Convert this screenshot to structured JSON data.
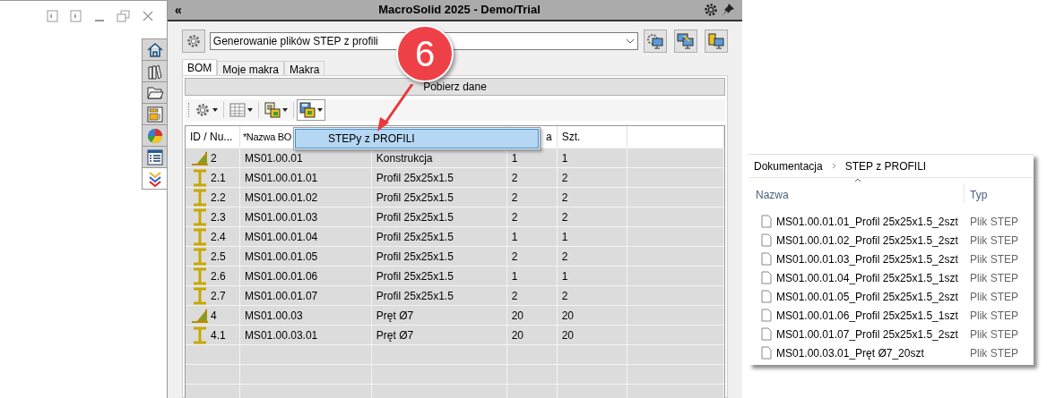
{
  "side_tabs": [
    {
      "kind": "home",
      "selected": false
    },
    {
      "kind": "library",
      "selected": false
    },
    {
      "kind": "folder",
      "selected": false
    },
    {
      "kind": "layout",
      "selected": false
    },
    {
      "kind": "color",
      "selected": false
    },
    {
      "kind": "list",
      "selected": false
    },
    {
      "kind": "expand",
      "selected": true
    }
  ],
  "panel": {
    "collapse_label": "«",
    "title": "MacroSolid 2025 - Demo/Trial",
    "macro_select": {
      "value": "Generowanie plików STEP z profili"
    },
    "tabs": [
      {
        "label": "BOM",
        "selected": true
      },
      {
        "label": "Moje makra",
        "selected": false
      },
      {
        "label": "Makra",
        "selected": false
      }
    ],
    "fetch_button": "Pobierz dane",
    "toolbar": [
      {
        "kind": "gear",
        "pressed": false
      },
      {
        "kind": "table",
        "pressed": false
      },
      {
        "kind": "export",
        "pressed": false
      },
      {
        "kind": "save",
        "pressed": true
      }
    ],
    "menu": {
      "items": [
        {
          "label": "STEPy z PROFILI",
          "selected": true
        }
      ]
    },
    "table": {
      "headers": [
        "ID / Nu...",
        "*Nazwa BO",
        "a",
        "Szt."
      ],
      "rows": [
        {
          "kind": "assembly",
          "id": "2",
          "name": "MS01.00.01",
          "column_3": "Konstrukcja",
          "column_4": "1",
          "szt": "1"
        },
        {
          "kind": "part",
          "id": "2.1",
          "name": "MS01.00.01.01",
          "column_3": "Profil 25x25x1.5",
          "column_4": "2",
          "szt": "2"
        },
        {
          "kind": "part",
          "id": "2.2",
          "name": "MS01.00.01.02",
          "column_3": "Profil 25x25x1.5",
          "column_4": "2",
          "szt": "2"
        },
        {
          "kind": "part",
          "id": "2.3",
          "name": "MS01.00.01.03",
          "column_3": "Profil 25x25x1.5",
          "column_4": "2",
          "szt": "2"
        },
        {
          "kind": "part",
          "id": "2.4",
          "name": "MS01.00.01.04",
          "column_3": "Profil 25x25x1.5",
          "column_4": "1",
          "szt": "1"
        },
        {
          "kind": "part",
          "id": "2.5",
          "name": "MS01.00.01.05",
          "column_3": "Profil 25x25x1.5",
          "column_4": "2",
          "szt": "2"
        },
        {
          "kind": "part",
          "id": "2.6",
          "name": "MS01.00.01.06",
          "column_3": "Profil 25x25x1.5",
          "column_4": "1",
          "szt": "1"
        },
        {
          "kind": "part",
          "id": "2.7",
          "name": "MS01.00.01.07",
          "column_3": "Profil 25x25x1.5",
          "column_4": "2",
          "szt": "2"
        },
        {
          "kind": "assembly",
          "id": "4",
          "name": "MS01.00.03",
          "column_3": "Pręt Ø7",
          "column_4": "20",
          "szt": "20"
        },
        {
          "kind": "part",
          "id": "4.1",
          "name": "MS01.00.03.01",
          "column_3": "Pręt Ø7",
          "column_4": "20",
          "szt": "20"
        }
      ]
    }
  },
  "callout": {
    "label": "6"
  },
  "explorer": {
    "breadcrumb": [
      "Dokumentacja",
      "STEP z PROFILI"
    ],
    "columns": {
      "name": "Nazwa",
      "type": "Typ"
    },
    "files": [
      {
        "name": "MS01.00.01.01_Profil 25x25x1.5_2szt",
        "type": "Plik STEP"
      },
      {
        "name": "MS01.00.01.02_Profil 25x25x1.5_2szt",
        "type": "Plik STEP"
      },
      {
        "name": "MS01.00.01.03_Profil 25x25x1.5_2szt",
        "type": "Plik STEP"
      },
      {
        "name": "MS01.00.01.04_Profil 25x25x1.5_1szt",
        "type": "Plik STEP"
      },
      {
        "name": "MS01.00.01.05_Profil 25x25x1.5_2szt",
        "type": "Plik STEP"
      },
      {
        "name": "MS01.00.01.06_Profil 25x25x1.5_1szt",
        "type": "Plik STEP"
      },
      {
        "name": "MS01.00.01.07_Profil 25x25x1.5_2szt",
        "type": "Plik STEP"
      },
      {
        "name": "MS01.00.03.01_Pręt Ø7_20szt",
        "type": "Plik STEP"
      }
    ]
  }
}
